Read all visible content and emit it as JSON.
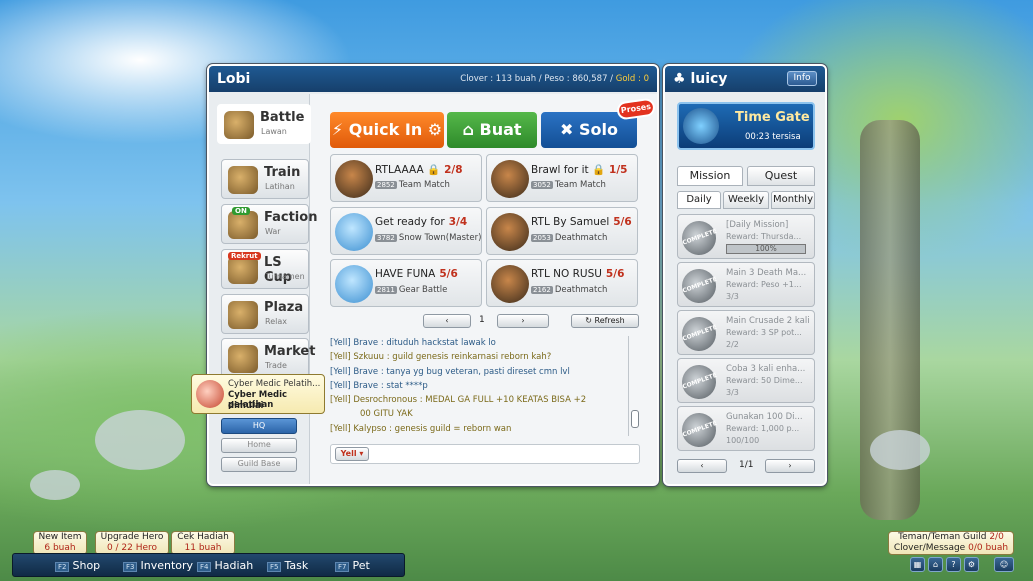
{
  "lobby": {
    "title": "Lobi",
    "clover": "Clover : 113 buah",
    "peso": "Peso : 860,587",
    "gold": "Gold : 0"
  },
  "nav": [
    {
      "label": "Battle",
      "sub": "Lawan"
    },
    {
      "label": "Train",
      "sub": "Latihan"
    },
    {
      "label": "Faction",
      "sub": "War",
      "tag": "ON"
    },
    {
      "label": "LS Cup",
      "sub": "Turnamen",
      "tag": "Rekrut"
    },
    {
      "label": "Plaza",
      "sub": "Relax"
    },
    {
      "label": "Market",
      "sub": "Trade"
    }
  ],
  "side_small": {
    "hq": "HQ",
    "home": "Home",
    "guild": "Guild Base"
  },
  "buttons": {
    "quick": "Quick In",
    "buat": "Buat",
    "solo": "Solo",
    "proses": "Proses"
  },
  "rooms": [
    {
      "name": "RTLAAAA",
      "locked": true,
      "count": "2/8",
      "num": "2852",
      "mode": "Team Match",
      "avatar": "dark"
    },
    {
      "name": "Brawl for it",
      "locked": true,
      "count": "1/5",
      "num": "3052",
      "mode": "Team Match",
      "avatar": "dark"
    },
    {
      "name": "Get ready for",
      "locked": false,
      "count": "3/4",
      "num": "3782",
      "mode": "Snow Town(Master)",
      "avatar": "blue"
    },
    {
      "name": "RTL By Samuel",
      "locked": false,
      "count": "5/6",
      "num": "2053",
      "mode": "Deathmatch",
      "avatar": "dark"
    },
    {
      "name": "HAVE FUNA",
      "locked": false,
      "count": "5/6",
      "num": "2811",
      "mode": "Gear Battle",
      "avatar": "blue"
    },
    {
      "name": "RTL NO RUSU",
      "locked": false,
      "count": "5/6",
      "num": "2162",
      "mode": "Deathmatch",
      "avatar": "dark"
    }
  ],
  "pager": {
    "page": "1",
    "refresh": "Refresh"
  },
  "chat": [
    {
      "text": "[Yell] Brave : dituduh hackstat lawak lo",
      "style": "c1"
    },
    {
      "text": "[Yell] Szkuuu : guild genesis reinkarnasi reborn kah?",
      "style": "c2"
    },
    {
      "text": "[Yell] Brave : tanya yg bug veteran, pasti direset cmn lvl",
      "style": "c1"
    },
    {
      "text": "[Yell] Brave : stat ****p",
      "style": "c1"
    },
    {
      "text": "[Yell] Desrochronous : MEDAL GA FULL +10 KEATAS BISA +2",
      "style": "c2"
    },
    {
      "text": "00 GITU YAK",
      "style": "c2"
    },
    {
      "text": "[Yell] Kalypso : genesis guild = reborn wan",
      "style": "c2"
    }
  ],
  "chat_mode": "Yell",
  "tooltip": {
    "title": "Cyber Medic Pelatih...",
    "line1": "Cyber Medic pelatihan",
    "line2": "dimulai"
  },
  "user": {
    "name": "luicy",
    "info": "Info"
  },
  "timegate": {
    "title": "Time Gate",
    "time": "00:23 tersisa"
  },
  "tabs": {
    "mission": "Mission",
    "quest": "Quest",
    "daily": "Daily",
    "weekly": "Weekly",
    "monthly": "Monthly"
  },
  "missions": [
    {
      "t1": "[Daily Mission]",
      "t2": "Reward: Thursda...",
      "t3": "100%",
      "progress": 1.0,
      "badge": "COMPLETE"
    },
    {
      "t1": "Main 3 Death Ma...",
      "t2": "Reward: Peso +1...",
      "t3": "3/3",
      "badge": "COMPLETE"
    },
    {
      "t1": "Main Crusade 2 kali",
      "t2": "Reward: 3 SP pot...",
      "t3": "2/2",
      "badge": "COMPLETE"
    },
    {
      "t1": "Coba 3 kali enha...",
      "t2": "Reward: 50 Dime...",
      "t3": "3/3",
      "badge": "COMPLETE"
    },
    {
      "t1": "Gunakan 100 Di...",
      "t2": "Reward: 1,000 p...",
      "t3": "100/100",
      "badge": "COMPLETE"
    }
  ],
  "mission_page": "1/1",
  "notes": {
    "new_item": {
      "l1": "New Item",
      "l2": "6 buah"
    },
    "upgrade": {
      "l1": "Upgrade Hero",
      "l2": "0 / 22 Hero"
    },
    "hadiah": {
      "l1": "Cek Hadiah",
      "l2": "11 buah"
    },
    "friends": {
      "l1": "Teman/Teman Guild",
      "v1": "2/0",
      "l2": "Clover/Message",
      "v2": "0/0 buah"
    }
  },
  "bottombar": [
    {
      "key": "F2",
      "label": "Shop"
    },
    {
      "key": "F3",
      "label": "Inventory"
    },
    {
      "key": "F4",
      "label": "Hadiah"
    },
    {
      "key": "F5",
      "label": "Task"
    },
    {
      "key": "F7",
      "label": "Pet"
    }
  ]
}
